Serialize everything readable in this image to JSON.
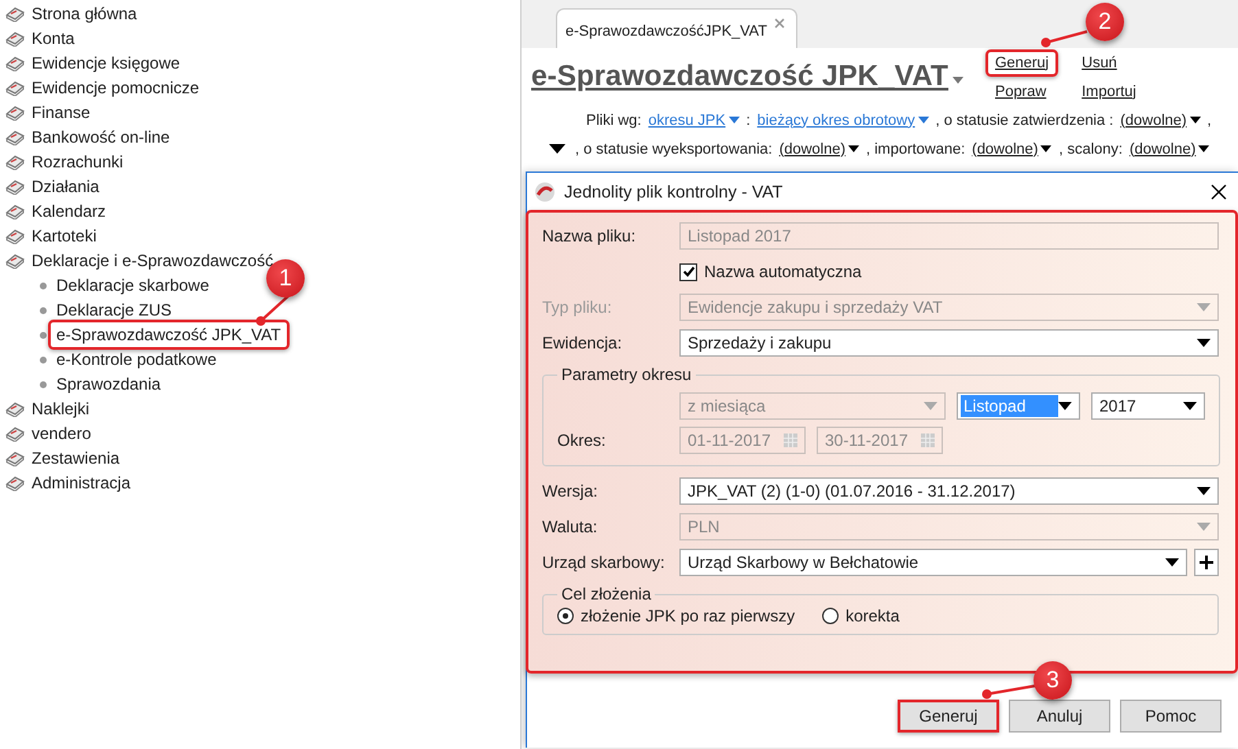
{
  "sidebar": {
    "items": [
      {
        "label": "Strona główna"
      },
      {
        "label": "Konta"
      },
      {
        "label": "Ewidencje księgowe"
      },
      {
        "label": "Ewidencje pomocnicze"
      },
      {
        "label": "Finanse"
      },
      {
        "label": "Bankowość on-line"
      },
      {
        "label": "Rozrachunki"
      },
      {
        "label": "Działania"
      },
      {
        "label": "Kalendarz"
      },
      {
        "label": "Kartoteki"
      },
      {
        "label": "Deklaracje i e-Sprawozdawczość",
        "children": [
          {
            "label": "Deklaracje skarbowe",
            "highlighted": false
          },
          {
            "label": "Deklaracje ZUS",
            "highlighted": false
          },
          {
            "label": "e-Sprawozdawczość JPK_VAT",
            "highlighted": true,
            "callout": "1"
          },
          {
            "label": "e-Kontrole podatkowe",
            "highlighted": false
          },
          {
            "label": "Sprawozdania",
            "highlighted": false
          }
        ]
      },
      {
        "label": "Naklejki"
      },
      {
        "label": "vendero"
      },
      {
        "label": "Zestawienia"
      },
      {
        "label": "Administracja"
      }
    ]
  },
  "tab": {
    "label": "e-SprawozdawczośćJPK_VAT"
  },
  "header": {
    "title": "e-Sprawozdawczość JPK_VAT",
    "actions": [
      {
        "label": "Generuj",
        "highlighted": true,
        "callout": "2"
      },
      {
        "label": "Usuń",
        "highlighted": false
      },
      {
        "label": "Popraw",
        "highlighted": false
      },
      {
        "label": "Importuj",
        "highlighted": false
      }
    ]
  },
  "filters": [
    [
      {
        "kind": "text",
        "text": "Pliki wg:"
      },
      {
        "kind": "link",
        "text": "okresu JPK"
      },
      {
        "kind": "text",
        "text": ":"
      },
      {
        "kind": "link",
        "text": "bieżący okres obrotowy"
      },
      {
        "kind": "text",
        "text": ", o statusie zatwierdzenia :"
      },
      {
        "kind": "dropdown",
        "text": "(dowolne)"
      },
      {
        "kind": "text",
        "text": ","
      }
    ],
    [
      {
        "kind": "arrow"
      },
      {
        "kind": "text",
        "text": ", o statusie wyeksportowania:"
      },
      {
        "kind": "dropdown",
        "text": "(dowolne)"
      },
      {
        "kind": "text",
        "text": ", importowane:"
      },
      {
        "kind": "dropdown",
        "text": "(dowolne)"
      },
      {
        "kind": "text",
        "text": ", scalony:"
      },
      {
        "kind": "dropdown",
        "text": "(dowolne)"
      }
    ]
  ],
  "dialog": {
    "title": "Jednolity plik kontrolny - VAT",
    "highlighted": true,
    "rows": [
      {
        "kind": "text",
        "label": "Nazwa pliku:",
        "value": "Listopad 2017",
        "disabled": true,
        "label_disabled": false
      },
      {
        "kind": "checkbox",
        "label": "Nazwa automatyczna",
        "checked": true
      },
      {
        "kind": "select",
        "label": "Typ pliku:",
        "value": "Ewidencje zakupu i sprzedaży VAT",
        "disabled": true,
        "label_disabled": true
      },
      {
        "kind": "select",
        "label": "Ewidencja:",
        "value": "Sprzedaży i zakupu",
        "disabled": false,
        "label_disabled": false
      },
      {
        "kind": "period",
        "title": "Parametry okresu",
        "range": {
          "value": "z miesiąca",
          "disabled": true
        },
        "month": {
          "value": "Listopad",
          "selected": true
        },
        "year": {
          "value": "2017"
        },
        "label": "Okres:",
        "from": {
          "value": "01-11-2017",
          "disabled": true
        },
        "to": {
          "value": "30-11-2017",
          "disabled": true
        }
      },
      {
        "kind": "select",
        "label": "Wersja:",
        "value": "JPK_VAT (2) (1-0) (01.07.2016 - 31.12.2017)",
        "disabled": false,
        "label_disabled": false
      },
      {
        "kind": "select",
        "label": "Waluta:",
        "value": "PLN",
        "disabled": true,
        "label_disabled": false
      },
      {
        "kind": "select",
        "label": "Urząd skarbowy:",
        "value": "Urząd Skarbowy w Bełchatowie",
        "disabled": false,
        "label_disabled": false,
        "add_button": true
      },
      {
        "kind": "radios",
        "title": "Cel złożenia",
        "options": [
          {
            "label": "złożenie JPK po raz pierwszy",
            "selected": true
          },
          {
            "label": "korekta",
            "selected": false
          }
        ]
      }
    ],
    "buttons": [
      {
        "label": "Generuj",
        "highlighted": true,
        "callout": "3"
      },
      {
        "label": "Anuluj",
        "highlighted": false
      },
      {
        "label": "Pomoc",
        "highlighted": false
      }
    ]
  }
}
